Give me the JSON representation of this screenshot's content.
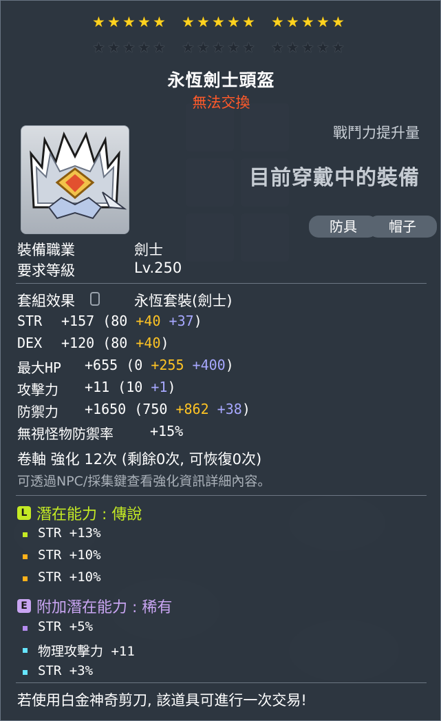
{
  "stars": {
    "filled": 15,
    "empty": 15
  },
  "item": {
    "name": "永恆劍士頭盔",
    "trade_status": "無法交換",
    "cp_label": "戰鬥力提升量",
    "cp_value": "目前穿戴中的裝備",
    "tags": [
      "防具",
      "帽子"
    ]
  },
  "requirements": {
    "job_label": "裝備職業",
    "job_value": "劍士",
    "level_label": "要求等級",
    "level_value": "Lv.250"
  },
  "set": {
    "label": "套組效果",
    "value": "永恆套裝(劍士)"
  },
  "stats": [
    {
      "name": "STR",
      "total": "+157",
      "open": "(80 ",
      "add1": "+40",
      "add2": " +37",
      "close": ")"
    },
    {
      "name": "DEX",
      "total": "+120",
      "open": "(80 ",
      "add1": "+40",
      "add2": "",
      "close": ")"
    },
    {
      "name": "最大HP",
      "total": "+655",
      "open": "(0 ",
      "add1": "+255",
      "add2": " +400",
      "close": ")"
    },
    {
      "name": "攻擊力",
      "total": "+11",
      "open": "(10 ",
      "add1": "",
      "add2": "+1",
      "close": ")"
    },
    {
      "name": "防禦力",
      "total": "+1650",
      "open": "(750 ",
      "add1": "+862",
      "add2": " +38",
      "close": ")"
    },
    {
      "name": "無視怪物防禦率",
      "total": "+15%",
      "open": "",
      "add1": "",
      "add2": "",
      "close": ""
    }
  ],
  "scroll": {
    "line": "卷軸 強化 12次 (剩餘0次, 可恢復0次)",
    "hint": "可透過NPC/採集鍵查看強化資訊詳細內容。"
  },
  "potential": {
    "badge": "L",
    "title": "潛在能力 : 傳說",
    "color": "#c4ea24",
    "lines": [
      {
        "text": "STR +13%",
        "bullet": "#c4ea24"
      },
      {
        "text": "STR +10%",
        "bullet": "#ffb11a"
      },
      {
        "text": "STR +10%",
        "bullet": "#ffb11a"
      }
    ]
  },
  "bonus_potential": {
    "badge": "E",
    "title": "附加潛在能力 : 稀有",
    "color": "#c9a5f2",
    "lines": [
      {
        "text": "STR +5%",
        "bullet": "#b58cf0"
      },
      {
        "text": "物理攻擊力 +11",
        "bullet": "#66e5ff"
      },
      {
        "text": "STR +3%",
        "bullet": "#66e5ff"
      }
    ]
  },
  "footer": "若使用白金神奇剪刀, 該道具可進行一次交易!"
}
